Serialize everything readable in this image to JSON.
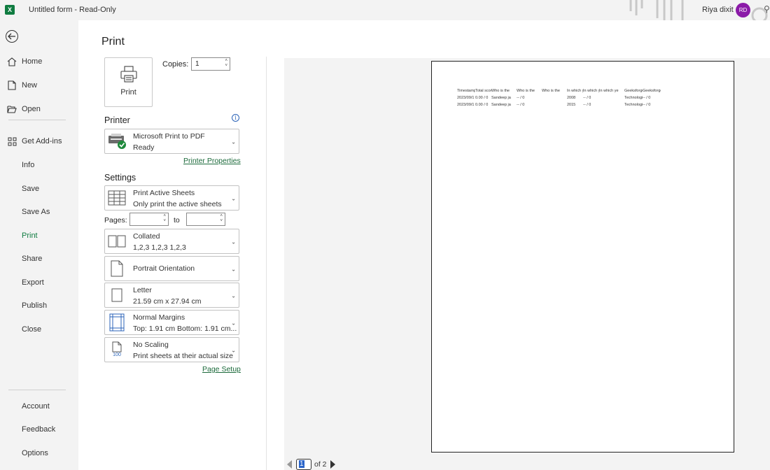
{
  "titlebar": {
    "app_logo_letter": "X",
    "title": "Untitled form  -  Read-Only",
    "user_name": "Riya dixit",
    "avatar_initials": "RD"
  },
  "nav": {
    "top_items": [
      {
        "label": "Home",
        "icon": "home-icon"
      },
      {
        "label": "New",
        "icon": "new-document-icon"
      },
      {
        "label": "Open",
        "icon": "open-folder-icon"
      }
    ],
    "addins_label": "Get Add-ins",
    "sub_items": [
      "Info",
      "Save",
      "Save As",
      "Print",
      "Share",
      "Export",
      "Publish",
      "Close"
    ],
    "active_item": "Print",
    "bottom_items": [
      "Account",
      "Feedback",
      "Options"
    ]
  },
  "print_panel": {
    "title": "Print",
    "print_button_label": "Print",
    "copies_label": "Copies:",
    "copies_value": "1",
    "printer_section_title": "Printer",
    "printer_name": "Microsoft Print to PDF",
    "printer_status": "Ready",
    "printer_properties_link": "Printer Properties",
    "settings_section_title": "Settings",
    "sheets_option": {
      "line1": "Print Active Sheets",
      "line2": "Only print the active sheets"
    },
    "pages_label": "Pages:",
    "pages_from": "",
    "pages_to_label": "to",
    "pages_to": "",
    "collate_option": {
      "line1": "Collated",
      "line2": "1,2,3    1,2,3    1,2,3"
    },
    "orientation_option": {
      "line1": "Portrait Orientation"
    },
    "paper_option": {
      "line1": "Letter",
      "line2": "21.59 cm x 27.94 cm"
    },
    "margins_option": {
      "line1": "Normal Margins",
      "line2": "Top: 1.91 cm Bottom: 1.91 cm..."
    },
    "scaling_option": {
      "line1": "No Scaling",
      "line2": "Print sheets at their actual size",
      "icon_text": "100"
    },
    "page_setup_link": "Page Setup"
  },
  "preview": {
    "sheet_header": [
      "Timestamp",
      "Total score",
      "Who is the",
      "Who is the",
      "Who is the",
      "In which ye",
      "In which ye",
      "In which ye",
      "Geeksforge",
      "Geeksforge"
    ],
    "sheet_rows": [
      [
        "2023/09/1",
        "0.00 / 0",
        "Sandeep ja",
        "-- / 0",
        "",
        "2008",
        "-- / 0",
        "",
        "Technologi",
        "-- / 0"
      ],
      [
        "2023/09/1",
        "0.00 / 0",
        "Sandeep ja",
        "-- / 0",
        "",
        "2015",
        "-- / 0",
        "",
        "Technologi",
        "-- / 0"
      ]
    ],
    "current_page": "1",
    "page_of": "of 2"
  }
}
